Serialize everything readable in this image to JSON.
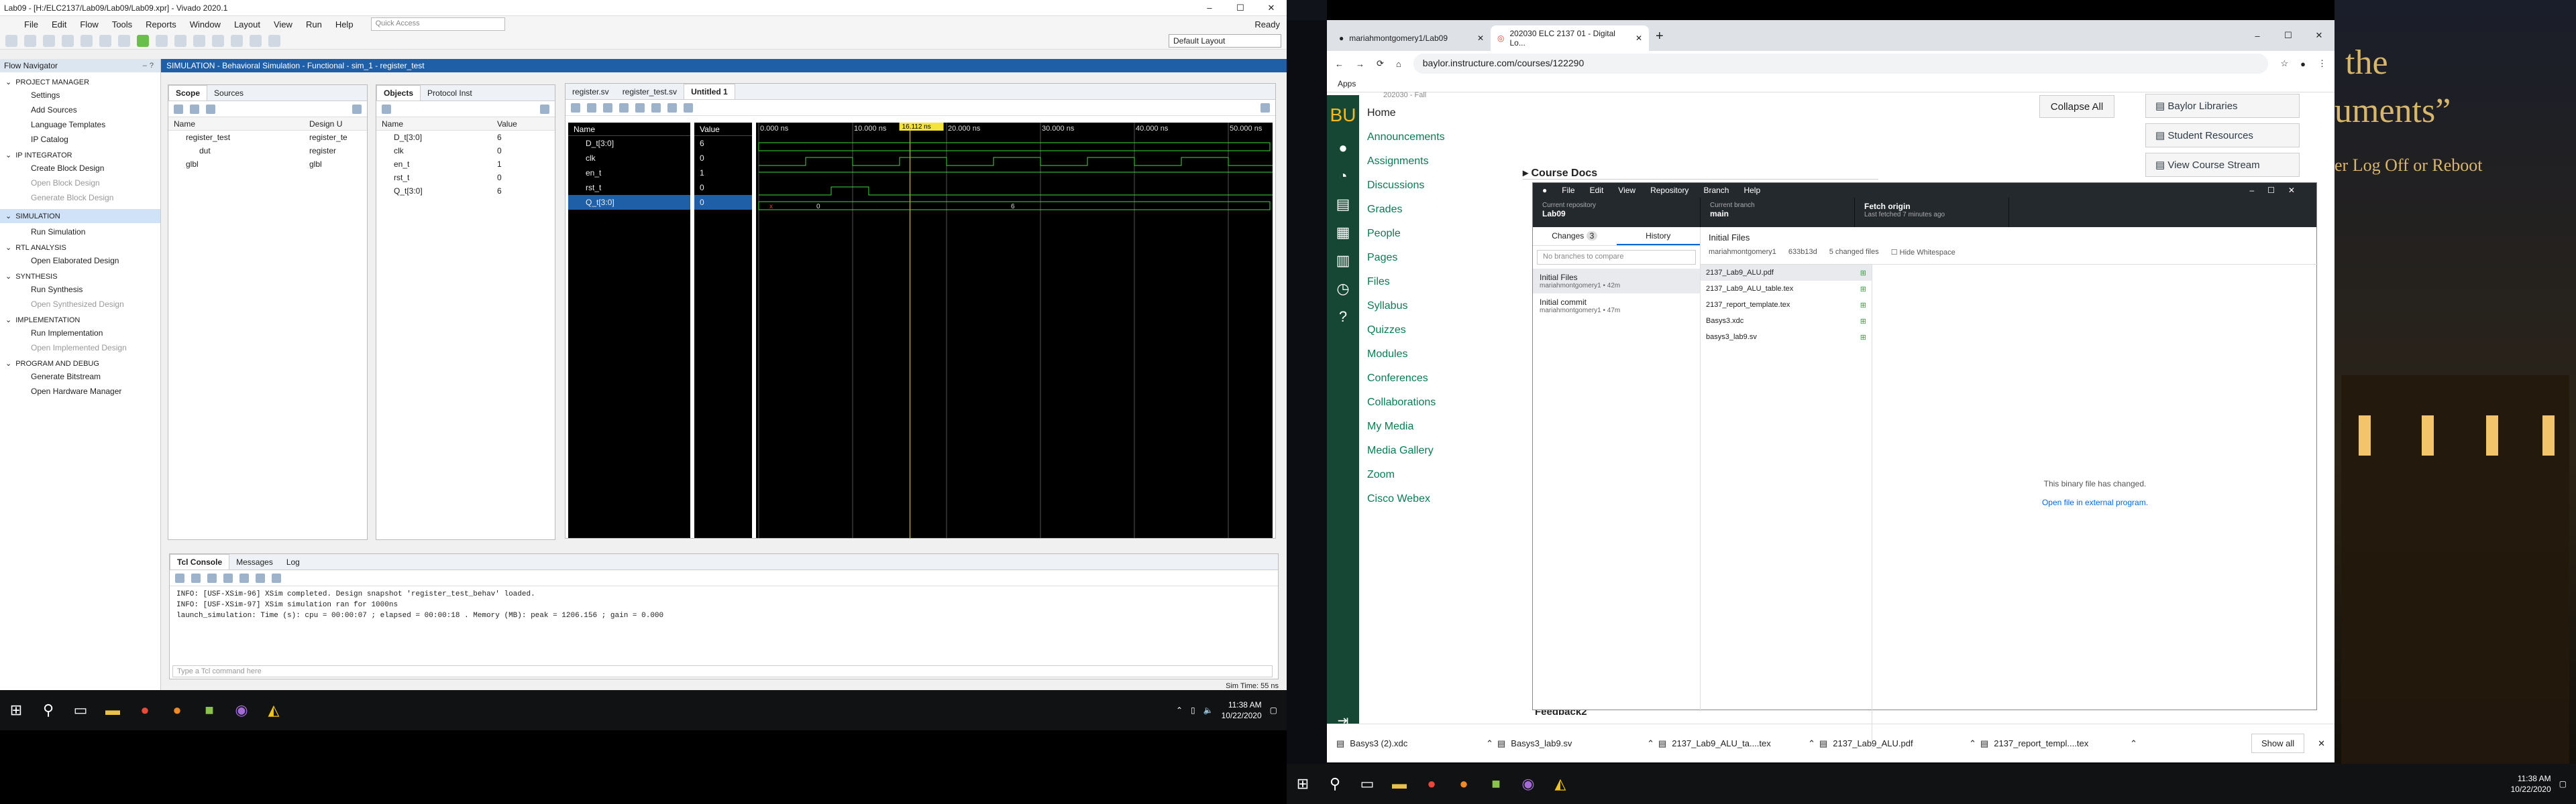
{
  "vivado": {
    "title": "Lab09 - [H:/ELC2137/Lab09/Lab09/Lab09.xpr] - Vivado 2020.1",
    "menus": [
      "File",
      "Edit",
      "Flow",
      "Tools",
      "Reports",
      "Window",
      "Layout",
      "View",
      "Run",
      "Help"
    ],
    "quick_access": "Quick Access",
    "status": "Ready",
    "layout": "Default Layout",
    "flow_nav_title": "Flow Navigator",
    "flow_nav": [
      {
        "section": "PROJECT MANAGER",
        "items": [
          {
            "label": "Settings",
            "enabled": true
          },
          {
            "label": "Add Sources",
            "enabled": true
          },
          {
            "label": "Language Templates",
            "enabled": true
          },
          {
            "label": "IP Catalog",
            "enabled": true
          }
        ]
      },
      {
        "section": "IP INTEGRATOR",
        "items": [
          {
            "label": "Create Block Design",
            "enabled": true
          },
          {
            "label": "Open Block Design",
            "enabled": false
          },
          {
            "label": "Generate Block Design",
            "enabled": false
          }
        ]
      },
      {
        "section": "SIMULATION",
        "items": [
          {
            "label": "Run Simulation",
            "enabled": true
          }
        ]
      },
      {
        "section": "RTL ANALYSIS",
        "items": [
          {
            "label": "Open Elaborated Design",
            "enabled": true
          }
        ]
      },
      {
        "section": "SYNTHESIS",
        "items": [
          {
            "label": "Run Synthesis",
            "enabled": true
          },
          {
            "label": "Open Synthesized Design",
            "enabled": false
          }
        ]
      },
      {
        "section": "IMPLEMENTATION",
        "items": [
          {
            "label": "Run Implementation",
            "enabled": true
          },
          {
            "label": "Open Implemented Design",
            "enabled": false
          }
        ]
      },
      {
        "section": "PROGRAM AND DEBUG",
        "items": [
          {
            "label": "Generate Bitstream",
            "enabled": true
          },
          {
            "label": "Open Hardware Manager",
            "enabled": true
          }
        ]
      }
    ],
    "sim_banner": "SIMULATION - Behavioral Simulation - Functional - sim_1 - register_test",
    "scope_tabs": [
      "Scope",
      "Sources"
    ],
    "scope_cols": [
      "Name",
      "Design U"
    ],
    "scope_rows": [
      {
        "name": "register_test",
        "unit": "register_te"
      },
      {
        "name": "dut",
        "unit": "register"
      },
      {
        "name": "glbl",
        "unit": "glbl"
      }
    ],
    "objects_tabs": [
      "Objects",
      "Protocol Inst"
    ],
    "objects_cols": [
      "Name",
      "Value"
    ],
    "objects_rows": [
      {
        "name": "D_t[3:0]",
        "value": "6"
      },
      {
        "name": "clk",
        "value": "0"
      },
      {
        "name": "en_t",
        "value": "1"
      },
      {
        "name": "rst_t",
        "value": "0"
      },
      {
        "name": "Q_t[3:0]",
        "value": "6"
      }
    ],
    "wave_tabs": [
      "register.sv",
      "register_test.sv",
      "Untitled 1"
    ],
    "wave_cols": [
      "Name",
      "Value"
    ],
    "cursor_time": "16.112 ns",
    "time_ticks": [
      "0.000 ns",
      "10.000 ns",
      "20.000 ns",
      "30.000 ns",
      "40.000 ns",
      "50.000 ns"
    ],
    "signals": [
      {
        "name": "D_t[3:0]",
        "value": "6"
      },
      {
        "name": "clk",
        "value": "0"
      },
      {
        "name": "en_t",
        "value": "1"
      },
      {
        "name": "rst_t",
        "value": "0"
      },
      {
        "name": "Q_t[3:0]",
        "value": "0"
      }
    ],
    "bus_labels": [
      "x",
      "0",
      "6"
    ],
    "tcl_tabs": [
      "Tcl Console",
      "Messages",
      "Log"
    ],
    "tcl_log": [
      "INFO: [USF-XSim-96] XSim completed. Design snapshot 'register_test_behav' loaded.",
      "INFO: [USF-XSim-97] XSim simulation ran for 1000ns",
      "launch_simulation: Time (s): cpu = 00:00:07 ; elapsed = 00:00:18 . Memory (MB): peak = 1206.156 ; gain = 0.000"
    ],
    "tcl_placeholder": "Type a Tcl command here",
    "sim_time": "Sim Time: 55 ns"
  },
  "taskbar_left": {
    "time": "11:38 AM",
    "date": "10/22/2020"
  },
  "taskbar_right": {
    "time": "11:38 AM",
    "date": "10/22/2020"
  },
  "chrome": {
    "tabs": [
      "mariahmontgomery1/Lab09",
      "202030 ELC 2137 01 - Digital Lo..."
    ],
    "url": "baylor.instructure.com/courses/122290",
    "bookmarks": "Apps",
    "term": "202030 - Fall",
    "nav": [
      "Home",
      "Announcements",
      "Assignments",
      "Discussions",
      "Grades",
      "People",
      "Pages",
      "Files",
      "Syllabus",
      "Quizzes",
      "Modules",
      "Conferences",
      "Collaborations",
      "My Media",
      "Media Gallery",
      "Zoom",
      "Cisco Webex"
    ],
    "collapse_all": "Collapse All",
    "right_links": [
      "Baylor Libraries",
      "Student Resources",
      "View Course Stream"
    ],
    "course_docs": "Course Docs",
    "feedback": "Feedback2",
    "downloads": [
      "Basys3 (2).xdc",
      "Basys3_lab9.sv",
      "2137_Lab9_ALU_ta....tex",
      "2137_Lab9_ALU.pdf",
      "2137_report_templ....tex"
    ],
    "show_all": "Show all"
  },
  "github": {
    "menus": [
      "File",
      "Edit",
      "View",
      "Repository",
      "Branch",
      "Help"
    ],
    "repo_label": "Current repository",
    "repo": "Lab09",
    "branch_label": "Current branch",
    "branch": "main",
    "fetch": "Fetch origin",
    "fetch_sub": "Last fetched 7 minutes ago",
    "tab_changes": "Changes",
    "changes_count": "3",
    "tab_history": "History",
    "filter": "No branches to compare",
    "commits": [
      {
        "title": "Initial Files",
        "meta": "mariahmontgomery1 • 42m"
      },
      {
        "title": "Initial commit",
        "meta": "mariahmontgomery1 • 47m"
      }
    ],
    "commit_title": "Initial Files",
    "commit_author": "mariahmontgomery1",
    "commit_sha": "633b13d",
    "commit_changed": "5 changed files",
    "hide_ws": "Hide Whitespace",
    "files": [
      "2137_Lab9_ALU.pdf",
      "2137_Lab9_ALU_table.tex",
      "2137_report_template.tex",
      "Basys3.xdc",
      "basys3_lab9.sv"
    ],
    "binary_msg": "This binary file has changed.",
    "open_ext": "Open file in external program."
  },
  "wallpaper": {
    "text1": "the",
    "text2": "uments”",
    "text3": "er Log Off or Reboot"
  }
}
